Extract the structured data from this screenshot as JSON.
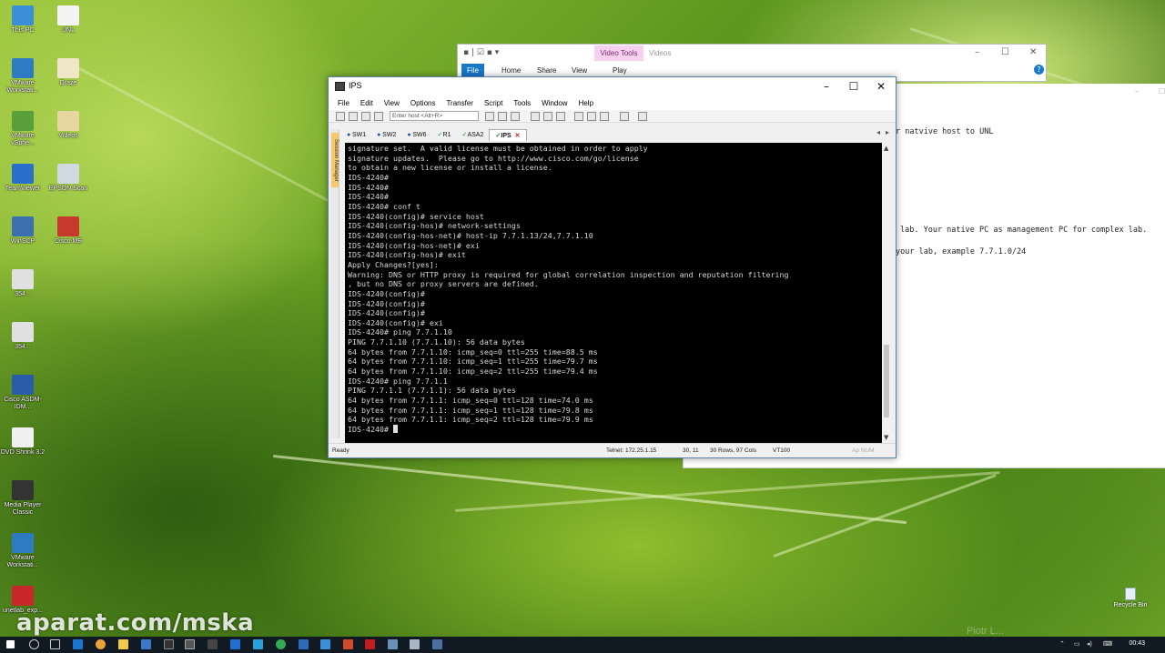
{
  "desktop": {
    "icons": [
      {
        "label": "This PC",
        "color": "#3a8fd8"
      },
      {
        "label": "UNL",
        "color": "#f4f4f4"
      },
      {
        "label": "VMware Workstati...",
        "color": "#2e7bc4"
      },
      {
        "label": "Draze",
        "color": "#f0e6c8"
      },
      {
        "label": "VMware vSphe...",
        "color": "#5aa03a"
      },
      {
        "label": "Videos",
        "color": "#e8d6a0"
      },
      {
        "label": "TeamViewer",
        "color": "#2a6fc9"
      },
      {
        "label": "EPSON Scan",
        "color": "#d0d8e0"
      },
      {
        "label": "WinSCP",
        "color": "#3b6fb0"
      },
      {
        "label": "Cisco ME",
        "color": "#c8382e"
      },
      {
        "label": "354...",
        "color": "#e0e0e0"
      },
      {
        "label": "354...",
        "color": "#e0e0e0"
      },
      {
        "label": "Cisco ASDM-IDM...",
        "color": "#2a5caa"
      },
      {
        "label": "DVD Shrink 3.2",
        "color": "#f0f0f0"
      },
      {
        "label": "Media Player Classic",
        "color": "#333333"
      },
      {
        "label": "VMware Workstati...",
        "color": "#2e7bc4"
      },
      {
        "label": "unetlab_exp...",
        "color": "#c82828"
      }
    ],
    "recycle_bin": "Recycle Bin",
    "watermark": "aparat.com/mska",
    "faint_name": "Piotr L..."
  },
  "explorer": {
    "context_tab": "Video Tools",
    "title": "Videos",
    "tabs": [
      "File",
      "Home",
      "Share",
      "View",
      "Play"
    ],
    "controls": {
      "min": "–",
      "max": "☐",
      "close": "✕"
    }
  },
  "document": {
    "lines": [
      "r natvive host to UNL",
      "lab. Your native PC as management PC for complex lab.",
      "your lab, example 7.7.1.0/24"
    ]
  },
  "crt": {
    "title": "IPS",
    "controls": {
      "min": "–",
      "max": "☐",
      "close": "✕"
    },
    "menu": [
      "File",
      "Edit",
      "View",
      "Options",
      "Transfer",
      "Script",
      "Tools",
      "Window",
      "Help"
    ],
    "host_placeholder": "Enter host <Alt+R>",
    "session_manager": "Session Manager",
    "tabs": [
      {
        "label": "SW1",
        "status": "blue"
      },
      {
        "label": "SW2",
        "status": "blue"
      },
      {
        "label": "SW6",
        "status": "blue"
      },
      {
        "label": "R1",
        "status": "green"
      },
      {
        "label": "ASA2",
        "status": "green"
      },
      {
        "label": "IPS",
        "status": "green",
        "active": true
      }
    ],
    "terminal_lines": [
      "signature set.  A valid license must be obtained in order to apply",
      "signature updates.  Please go to http://www.cisco.com/go/license",
      "to obtain a new license or install a license.",
      "IDS-4240#",
      "IDS-4240#",
      "IDS-4240#",
      "IDS-4240# conf t",
      "IDS-4240(config)# service host",
      "IDS-4240(config-hos)# network-settings",
      "IDS-4240(config-hos-net)# host-ip 7.7.1.13/24,7.7.1.10",
      "IDS-4240(config-hos-net)# exi",
      "IDS-4240(config-hos)# exit",
      "Apply Changes?[yes]:",
      "Warning: DNS or HTTP proxy is required for global correlation inspection and reputation filtering",
      ", but no DNS or proxy servers are defined.",
      "IDS-4240(config)#",
      "IDS-4240(config)#",
      "IDS-4240(config)#",
      "IDS-4240(config)# exi",
      "IDS-4240# ping 7.7.1.10",
      "PING 7.7.1.10 (7.7.1.10): 56 data bytes",
      "64 bytes from 7.7.1.10: icmp_seq=0 ttl=255 time=88.5 ms",
      "64 bytes from 7.7.1.10: icmp_seq=1 ttl=255 time=79.7 ms",
      "64 bytes from 7.7.1.10: icmp_seq=2 ttl=255 time=79.4 ms",
      "IDS-4240# ping 7.7.1.1",
      "PING 7.7.1.1 (7.7.1.1): 56 data bytes",
      "64 bytes from 7.7.1.1: icmp_seq=0 ttl=128 time=74.0 ms",
      "64 bytes from 7.7.1.1: icmp_seq=1 ttl=128 time=79.8 ms",
      "64 bytes from 7.7.1.1: icmp_seq=2 ttl=128 time=79.9 ms"
    ],
    "prompt": "IDS-4240# ",
    "status": {
      "ready": "Ready",
      "connection": "Telnet: 172.25.1.15",
      "cursor_pos": "30, 11",
      "size": "30 Rows, 97 Cols",
      "emulation": "VT100",
      "caps": "Ap  NUM"
    }
  },
  "taskbar": {
    "clock": "00:43",
    "tray_icons": [
      "up-chevron-icon",
      "network-icon",
      "volume-icon",
      "keyboard-icon"
    ]
  },
  "colors": {
    "terminal_bg": "#000000",
    "terminal_fg": "#d8d8d8",
    "accent": "#1979ca"
  }
}
